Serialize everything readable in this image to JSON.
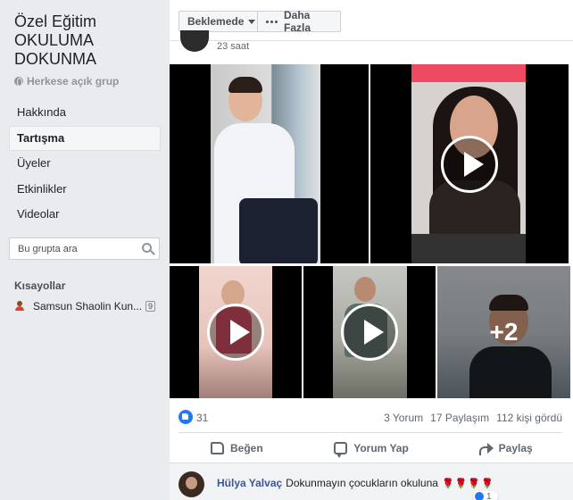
{
  "sidebar": {
    "group_title": "Özel Eğitim OKULUMA DOKUNMA",
    "privacy": "Herkese açık grup",
    "nav": [
      {
        "label": "Hakkında",
        "active": false
      },
      {
        "label": "Tartışma",
        "active": true
      },
      {
        "label": "Üyeler",
        "active": false
      },
      {
        "label": "Etkinlikler",
        "active": false
      },
      {
        "label": "Videolar",
        "active": false
      }
    ],
    "search_placeholder": "Bu grupta ara",
    "shortcuts_title": "Kısayollar",
    "shortcut": {
      "label": "Samsun Shaolin Kun...",
      "count": "9"
    }
  },
  "topbar": {
    "waiting_label": "Beklemede",
    "more_label": "Daha Fazla"
  },
  "post": {
    "time": "23 saat",
    "more_overlay": "+2",
    "likes": "31",
    "comments": "3 Yorum",
    "shares": "17 Paylaşım",
    "views": "112 kişi gördü",
    "actions": {
      "like": "Beğen",
      "comment": "Yorum Yap",
      "share": "Paylaş"
    },
    "comment": {
      "author": "Hülya Yalvaç",
      "text": "Dokunmayın çocukların okuluna",
      "emoji": "🌹🌹🌹🌹",
      "likes": "1"
    }
  },
  "colors": {
    "brand": "#385898",
    "like_blue": "#2078f4",
    "background": "#e9ebee"
  }
}
